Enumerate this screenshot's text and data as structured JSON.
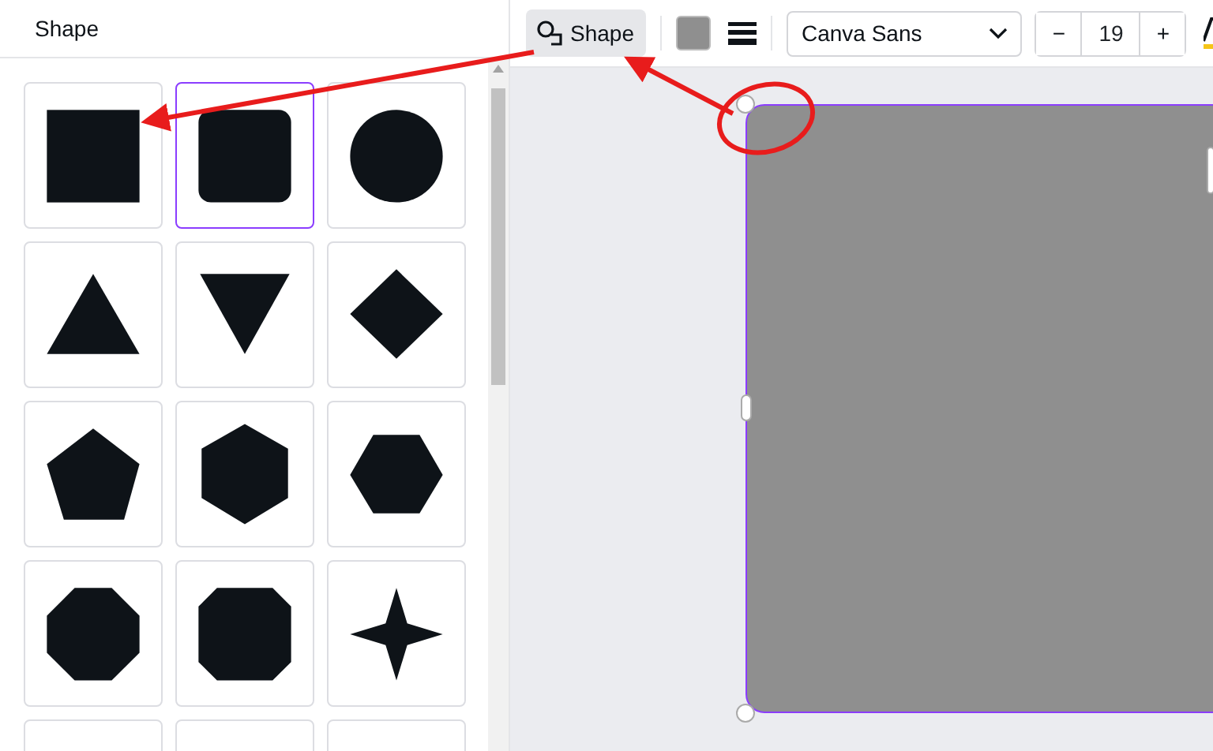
{
  "panel": {
    "title": "Shape"
  },
  "shapes": [
    {
      "kind": "square",
      "selected": false
    },
    {
      "kind": "rounded-square",
      "selected": true
    },
    {
      "kind": "circle",
      "selected": false
    },
    {
      "kind": "triangle",
      "selected": false
    },
    {
      "kind": "inverted-triangle",
      "selected": false
    },
    {
      "kind": "diamond",
      "selected": false
    },
    {
      "kind": "pentagon",
      "selected": false
    },
    {
      "kind": "hexagon-vertical",
      "selected": false
    },
    {
      "kind": "hexagon",
      "selected": false
    },
    {
      "kind": "octagon",
      "selected": false
    },
    {
      "kind": "cut-square",
      "selected": false
    },
    {
      "kind": "star",
      "selected": false
    },
    {
      "kind": "cut-off",
      "selected": false
    },
    {
      "kind": "cut-off",
      "selected": false
    },
    {
      "kind": "cut-off",
      "selected": false
    }
  ],
  "toolbar": {
    "shape_button": "Shape",
    "font": "Canva Sans",
    "font_size": "19",
    "decrease": "−",
    "increase": "+"
  }
}
